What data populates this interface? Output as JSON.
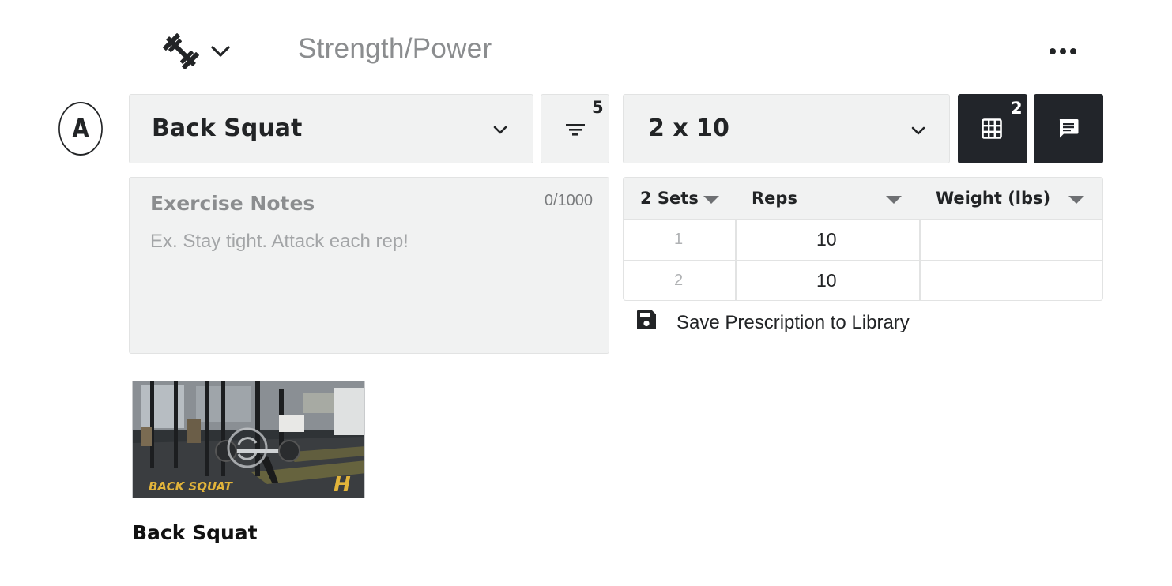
{
  "header": {
    "section_title": "Strength/Power",
    "type_icon": "barbell-icon",
    "menu_icon": "more-horizontal-icon"
  },
  "exercise": {
    "letter": "A",
    "name": "Back Squat",
    "filter_count": "5",
    "prescription": "2 x 10",
    "grid_count": "2"
  },
  "notes": {
    "label": "Exercise Notes",
    "counter": "0/1000",
    "placeholder": "Ex. Stay tight. Attack each rep!"
  },
  "sets_table": {
    "headers": [
      "2 Sets",
      "Reps",
      "Weight (lbs)"
    ],
    "rows": [
      {
        "set": "1",
        "reps": "10",
        "weight": ""
      },
      {
        "set": "2",
        "reps": "10",
        "weight": ""
      }
    ]
  },
  "save": {
    "label": "Save Prescription to Library"
  },
  "video": {
    "overlay_text": "BACK SQUAT",
    "logo_text": "H",
    "title": "Back Squat"
  },
  "colors": {
    "field_bg": "#f1f2f2",
    "dark_button": "#22252a",
    "muted_text": "#8b8d8f",
    "overlay_yellow": "#e2b43a"
  }
}
